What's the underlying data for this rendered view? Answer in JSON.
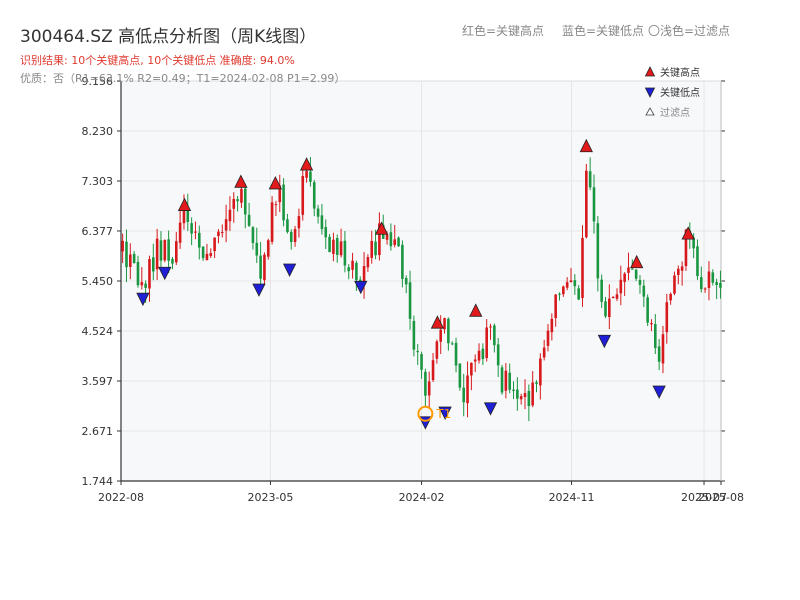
{
  "header": {
    "title": "300464.SZ 高低点分析图（周K线图）",
    "result_line": "识别结果: 10个关键高点, 10个关键低点   准确度: 94.0%",
    "quality_line": "优质：否（R1=63.1%  R2=0.49；T1=2024-02-08 P1=2.99）",
    "note_red": "红色=关键高点",
    "note_blue": "蓝色=关键低点",
    "note_hollow": "〇浅色=过滤点"
  },
  "colors": {
    "up": "#d7191c",
    "down": "#1a9641",
    "high_marker": "#e31a1c",
    "low_marker": "#1f1fd6",
    "t1_marker": "#ff9900",
    "grid": "#e6e6e6",
    "axis": "#333333"
  },
  "chart_data": {
    "type": "candlestick",
    "title": "300464.SZ 高低点分析图（周K线图）",
    "xlabel": "",
    "ylabel": "",
    "ylim": [
      1.744,
      9.156
    ],
    "yticks": [
      1.744,
      2.671,
      3.597,
      4.524,
      5.45,
      6.377,
      7.303,
      8.23,
      9.156
    ],
    "ytick_labels": [
      "1.744",
      "2.671",
      "3.597",
      "4.524",
      "5.450",
      "6.377",
      "7.303",
      "8.230",
      "9.156"
    ],
    "xlim": [
      "2022-08-01",
      "2025-08-01"
    ],
    "xticks": [
      "2022-08-01",
      "2023-05-01",
      "2024-02-01",
      "2024-11-01",
      "2025-07-01",
      "2025-08-01"
    ],
    "xtick_labels": [
      "2022-08",
      "2023-05",
      "2024-02",
      "2024-11",
      "2025-07",
      "2025-08"
    ],
    "grid": true,
    "anchors": [
      [
        "2022-08-01",
        6.0
      ],
      [
        "2022-09-10",
        5.3
      ],
      [
        "2022-10-10",
        6.1
      ],
      [
        "2022-11-05",
        5.85
      ],
      [
        "2022-11-25",
        6.9
      ],
      [
        "2022-12-26",
        5.85
      ],
      [
        "2023-02-15",
        6.7
      ],
      [
        "2023-03-08",
        7.2
      ],
      [
        "2023-04-10",
        5.5
      ],
      [
        "2023-05-15",
        7.2
      ],
      [
        "2023-06-05",
        5.85
      ],
      [
        "2023-07-06",
        7.55
      ],
      [
        "2023-08-01",
        6.4
      ],
      [
        "2023-09-01",
        6.0
      ],
      [
        "2023-10-13",
        5.55
      ],
      [
        "2023-11-20",
        6.4
      ],
      [
        "2023-12-20",
        6.0
      ],
      [
        "2024-01-10",
        4.8
      ],
      [
        "2024-02-08",
        3.3
      ],
      [
        "2024-02-29",
        4.4
      ],
      [
        "2024-03-18",
        4.6
      ],
      [
        "2024-04-20",
        3.3
      ],
      [
        "2024-05-10",
        4.0
      ],
      [
        "2024-06-06",
        4.5
      ],
      [
        "2024-06-26",
        3.6
      ],
      [
        "2024-08-26",
        3.3
      ],
      [
        "2024-09-15",
        4.3
      ],
      [
        "2024-10-08",
        5.4
      ],
      [
        "2024-11-15",
        5.3
      ],
      [
        "2024-11-28",
        7.6
      ],
      [
        "2024-12-31",
        4.6
      ],
      [
        "2025-01-20",
        5.3
      ],
      [
        "2025-02-28",
        5.7
      ],
      [
        "2025-03-20",
        4.9
      ],
      [
        "2025-04-10",
        3.9
      ],
      [
        "2025-04-30",
        5.2
      ],
      [
        "2025-05-30",
        6.2
      ],
      [
        "2025-06-25",
        5.5
      ],
      [
        "2025-08-01",
        5.55
      ]
    ],
    "key_highs": [
      {
        "date": "2022-11-25",
        "value": 6.7
      },
      {
        "date": "2023-03-08",
        "value": 7.13
      },
      {
        "date": "2023-05-10",
        "value": 7.1
      },
      {
        "date": "2023-07-06",
        "value": 7.45
      },
      {
        "date": "2023-11-20",
        "value": 6.26
      },
      {
        "date": "2024-03-01",
        "value": 4.52
      },
      {
        "date": "2024-05-10",
        "value": 4.74
      },
      {
        "date": "2024-11-28",
        "value": 7.79
      },
      {
        "date": "2025-02-28",
        "value": 5.64
      },
      {
        "date": "2025-06-02",
        "value": 6.17
      }
    ],
    "key_lows": [
      {
        "date": "2022-09-10",
        "value": 5.28
      },
      {
        "date": "2022-10-20",
        "value": 5.76
      },
      {
        "date": "2023-04-10",
        "value": 5.45
      },
      {
        "date": "2023-06-05",
        "value": 5.82
      },
      {
        "date": "2023-10-13",
        "value": 5.5
      },
      {
        "date": "2024-02-08",
        "value": 2.99
      },
      {
        "date": "2024-03-15",
        "value": 3.17
      },
      {
        "date": "2024-06-06",
        "value": 3.25
      },
      {
        "date": "2024-12-31",
        "value": 4.5
      },
      {
        "date": "2025-04-10",
        "value": 3.56
      }
    ],
    "t1": {
      "label": "T1",
      "date": "2024-02-08",
      "value": 2.99
    },
    "legend": {
      "placement": "top-right",
      "items": [
        {
          "name": "关键高点",
          "marker": "up-triangle",
          "color": "#e31a1c"
        },
        {
          "name": "关键低点",
          "marker": "down-triangle",
          "color": "#1f1fd6"
        },
        {
          "name": "过滤点",
          "marker": "hollow-triangle",
          "color": "#cccccc"
        }
      ]
    }
  }
}
